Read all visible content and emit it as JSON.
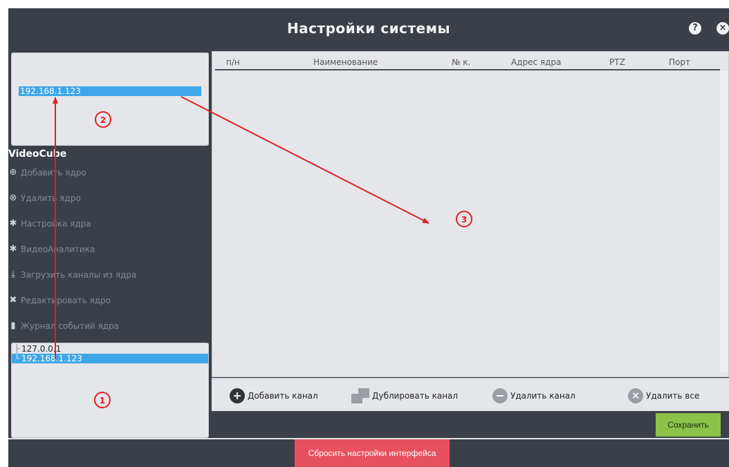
{
  "window": {
    "title": "Настройки системы"
  },
  "left": {
    "top_list": [
      "192.168.1.123"
    ],
    "section_title": "VideoCube",
    "actions": [
      {
        "label": "Добавить ядро",
        "icon": "plus-circle-icon"
      },
      {
        "label": "Удалить ядро",
        "icon": "close-circle-icon"
      },
      {
        "label": "Настройка ядра",
        "icon": "gear-icon"
      },
      {
        "label": "ВидеоАналитика",
        "icon": "gear-icon"
      },
      {
        "label": "Загрузить каналы из ядра",
        "icon": "download-icon"
      },
      {
        "label": "Редактировать ядро",
        "icon": "tools-icon"
      },
      {
        "label": "Журнал событий ядра",
        "icon": "book-icon"
      }
    ],
    "tree": [
      "127.0.0.1",
      "192.168.1.123"
    ]
  },
  "table": {
    "columns": [
      "п/н",
      "Наименование",
      "№ к.",
      "Адрес ядра",
      "PTZ",
      "Порт"
    ],
    "rows": []
  },
  "buttons": {
    "add_channel": "Добавить канал",
    "duplicate_channel": "Дублировать канал",
    "delete_channel": "Удалить канал",
    "delete_all": "Удалить все",
    "save": "Сохранить",
    "reset": "Сбросить настройки интерфейса"
  },
  "annotations": [
    "1",
    "2",
    "3"
  ],
  "colors": {
    "bg_dark": "#3b4048",
    "panel": "#e4e6ea",
    "selection": "#3fa6e8",
    "save": "#8bc34a",
    "reset": "#e7515f",
    "annotation": "#e02020"
  }
}
